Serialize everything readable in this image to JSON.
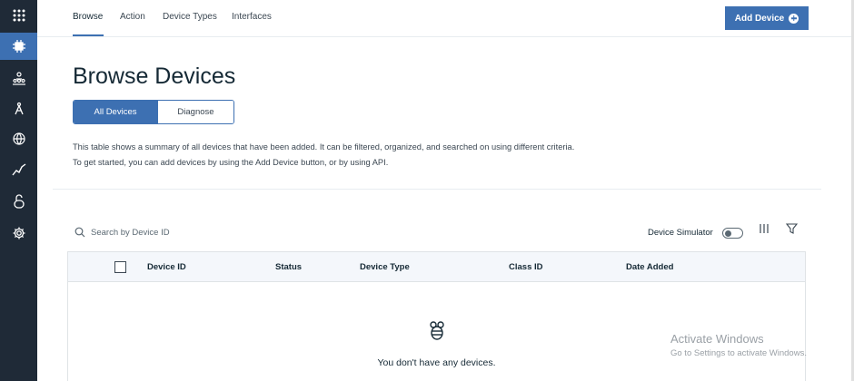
{
  "sidebar": {
    "icons": [
      "app-grid-icon",
      "chip-icon",
      "members-icon",
      "rules-icon",
      "security-icon",
      "analytics-icon",
      "lock-icon",
      "settings-icon"
    ]
  },
  "nav": {
    "tabs": [
      "Browse",
      "Action",
      "Device Types",
      "Interfaces"
    ],
    "active_tab": "Browse",
    "add_device_label": "Add Device"
  },
  "page": {
    "title": "Browse Devices",
    "segment": {
      "all_label": "All Devices",
      "diagnose_label": "Diagnose",
      "selected": "All Devices"
    },
    "description": "This table shows a summary of all devices that have been added. It can be filtered, organized, and searched on using different criteria. To get started, you can add devices by using the Add Device button, or by using API."
  },
  "toolbar": {
    "search_placeholder": "Search by Device ID",
    "simulator_label": "Device Simulator",
    "simulator_on": false
  },
  "table": {
    "columns": [
      "Device ID",
      "Status",
      "Device Type",
      "Class ID",
      "Date Added"
    ],
    "empty_message": "You don't have any devices."
  },
  "watermark": {
    "line1": "Activate Windows",
    "line2": "Go to Settings to activate Windows."
  },
  "colors": {
    "accent": "#3d70b2",
    "sidebar_bg": "#1f2a37",
    "header_bg": "#f4f7fb"
  }
}
